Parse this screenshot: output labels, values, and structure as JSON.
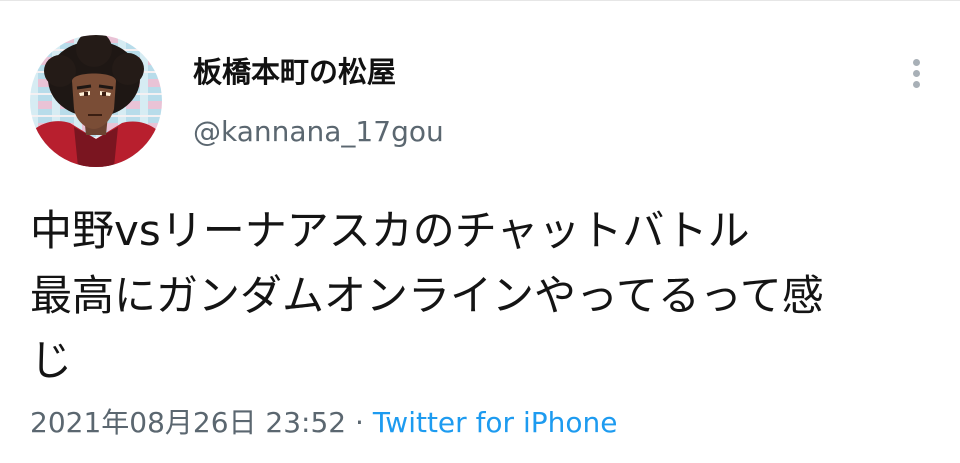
{
  "user": {
    "display_name": "板橋本町の松屋",
    "handle": "@kannana_17gou",
    "avatar_icon": "anime-character-avatar"
  },
  "tweet": {
    "lines": [
      "中野vsリーナアスカのチャットバトル",
      "最高にガンダムオンラインやってるって感",
      "じ"
    ],
    "timestamp": "2021年08月26日 23:52",
    "separator": "·",
    "source": "Twitter for iPhone"
  },
  "menu": {
    "icon": "more-vertical-icon"
  },
  "colors": {
    "link": "#1d9bf0",
    "secondary_text": "#5b6770",
    "primary_text": "#141414",
    "menu_dots": "#a8b0b7"
  }
}
